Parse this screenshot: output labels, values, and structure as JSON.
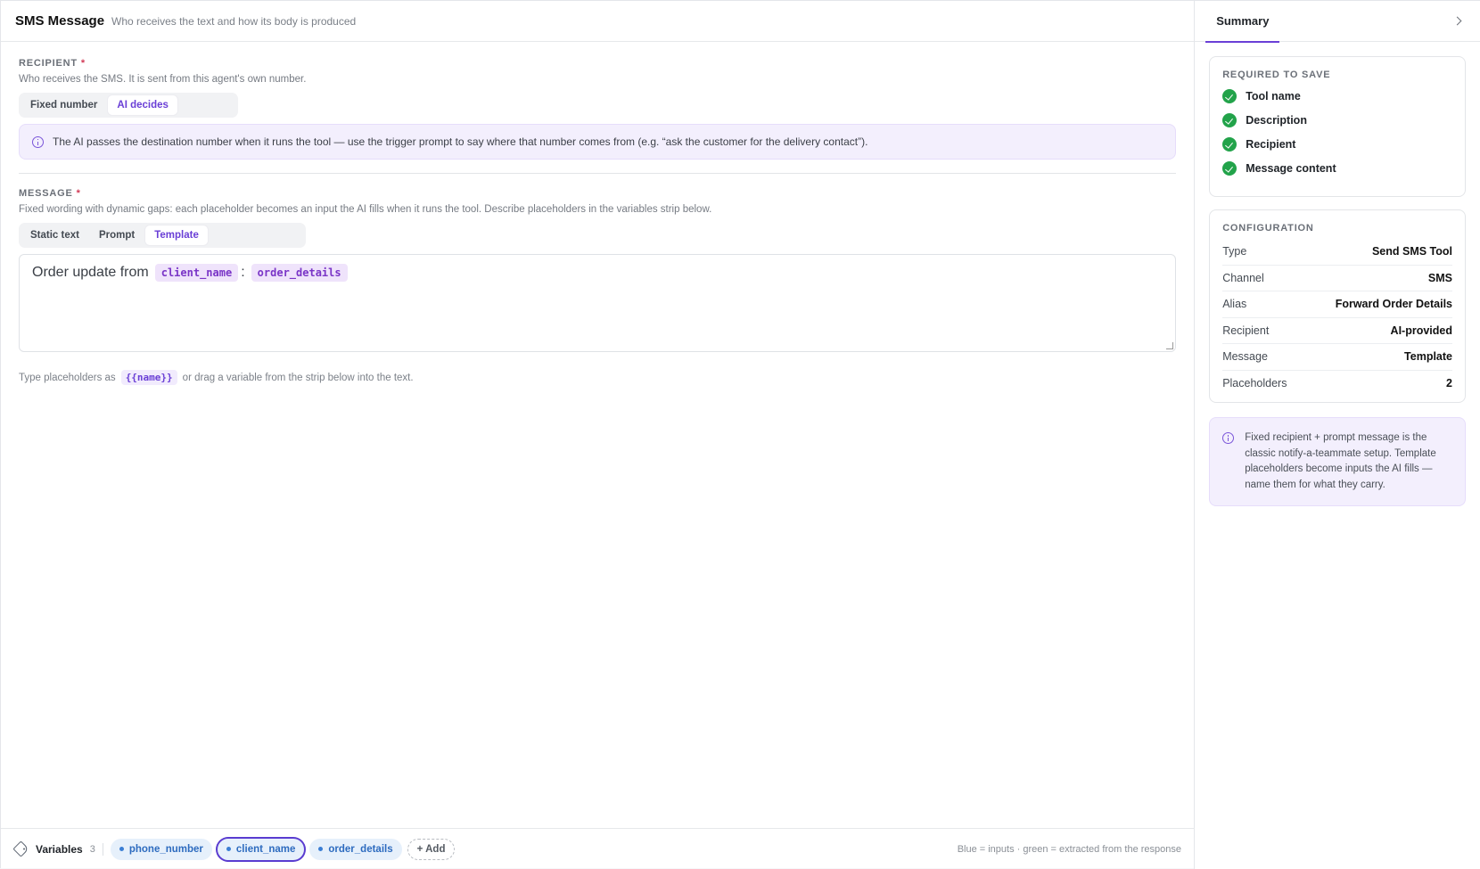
{
  "header": {
    "title": "SMS Message",
    "subtitle": "Who receives the text and how its body is produced"
  },
  "recipient": {
    "label": "RECIPIENT",
    "required_mark": "*",
    "description": "Who receives the SMS. It is sent from this agent's own number.",
    "options": [
      "Fixed number",
      "AI decides"
    ],
    "selected": "AI decides",
    "info": "The AI passes the destination number when it runs the tool — use the trigger prompt to say where that number comes from (e.g. “ask the customer for the delivery contact”)."
  },
  "message": {
    "label": "MESSAGE",
    "required_mark": "*",
    "description": "Fixed wording with dynamic gaps: each placeholder becomes an input the AI fills when it runs the tool. Describe placeholders in the variables strip below.",
    "options": [
      "Static text",
      "Prompt",
      "Template"
    ],
    "selected": "Template",
    "template_prefix": "Order update from",
    "placeholder_1": "client_name",
    "separator": ":",
    "placeholder_2": "order_details",
    "hint_before": "Type placeholders as",
    "hint_code": "{{name}}",
    "hint_after": "or drag a variable from the strip below into the text."
  },
  "variables": {
    "title": "Variables",
    "count": "3",
    "items": [
      "phone_number",
      "client_name",
      "order_details"
    ],
    "selected": "client_name",
    "add_label": "+ Add",
    "legend": "Blue = inputs · green = extracted from the response"
  },
  "sidebar": {
    "tab": "Summary",
    "required": {
      "title": "REQUIRED TO SAVE",
      "items": [
        "Tool name",
        "Description",
        "Recipient",
        "Message content"
      ]
    },
    "config": {
      "title": "CONFIGURATION",
      "rows": [
        {
          "k": "Type",
          "v": "Send SMS Tool"
        },
        {
          "k": "Channel",
          "v": "SMS"
        },
        {
          "k": "Alias",
          "v": "Forward Order Details"
        },
        {
          "k": "Recipient",
          "v": "AI-provided"
        },
        {
          "k": "Message",
          "v": "Template"
        },
        {
          "k": "Placeholders",
          "v": "2"
        }
      ]
    },
    "note": "Fixed recipient + prompt message is the classic notify-a-teammate setup. Template placeholders become inputs the AI fills — name them for what they carry."
  },
  "colors": {
    "accent": "#6a3fd6",
    "success": "#22a34a",
    "variable_blue": "#2d6bbf"
  }
}
